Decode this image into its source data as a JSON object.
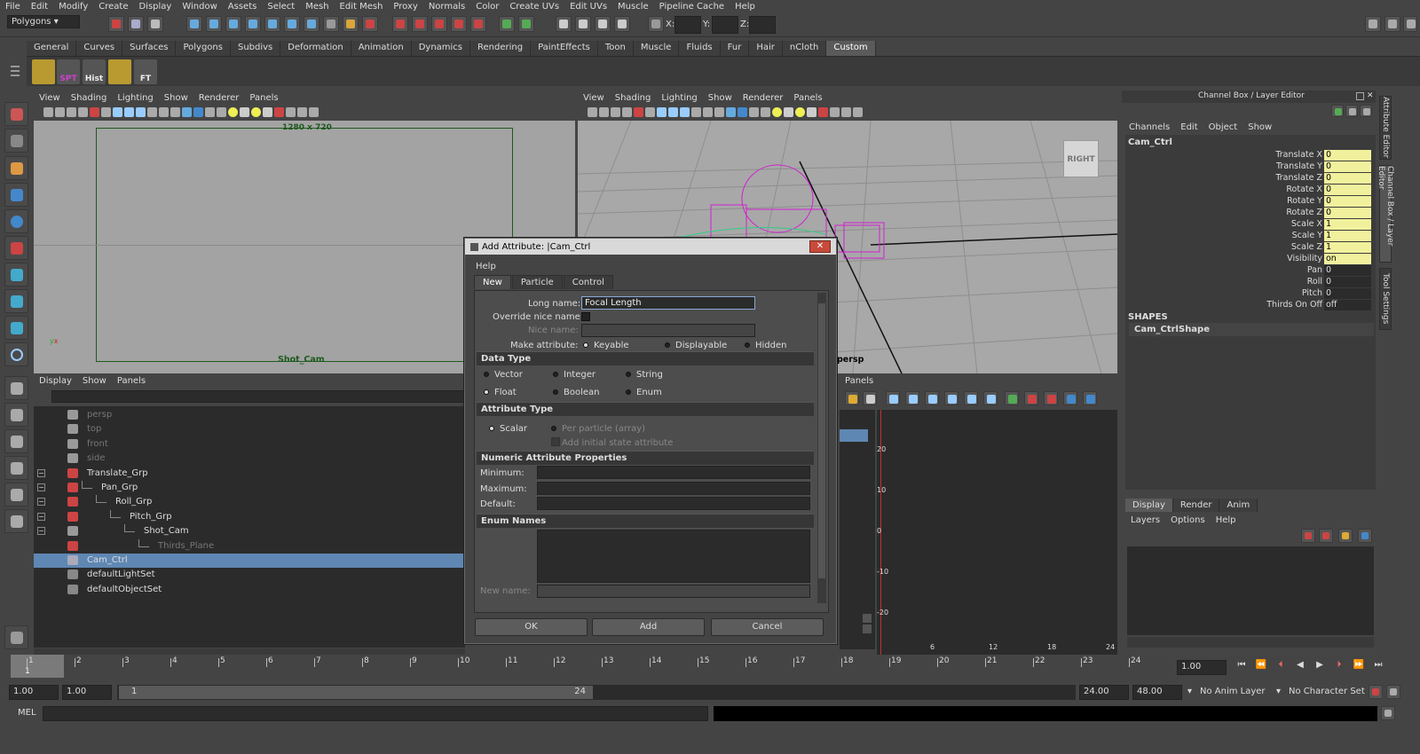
{
  "menubar": [
    "File",
    "Edit",
    "Modify",
    "Create",
    "Display",
    "Window",
    "Assets",
    "Select",
    "Mesh",
    "Edit Mesh",
    "Proxy",
    "Normals",
    "Color",
    "Create UVs",
    "Edit UVs",
    "Muscle",
    "Pipeline Cache",
    "Help"
  ],
  "status": {
    "menuset": "Polygons",
    "x_label": "X:",
    "y_label": "Y:",
    "z_label": "Z:"
  },
  "shelf": {
    "tabs": [
      "General",
      "Curves",
      "Surfaces",
      "Polygons",
      "Subdivs",
      "Deformation",
      "Animation",
      "Dynamics",
      "Rendering",
      "PaintEffects",
      "Toon",
      "Muscle",
      "Fluids",
      "Fur",
      "Hair",
      "nCloth",
      "Custom"
    ],
    "active": "Custom",
    "icons": [
      {
        "label": "",
        "color": "#c9a83a"
      },
      {
        "label": "SPT",
        "color": "#c03ac0"
      },
      {
        "label": "Hist",
        "color": "#dddddd"
      },
      {
        "label": "",
        "color": "#c9a83a"
      },
      {
        "label": "FT",
        "color": "#dddddd"
      }
    ]
  },
  "viewport_menu": [
    "View",
    "Shading",
    "Lighting",
    "Show",
    "Renderer",
    "Panels"
  ],
  "viewport1": {
    "resolution": "1280 x 720",
    "camera": "Shot_Cam"
  },
  "viewport2": {
    "camera": "persp",
    "viewcube": "RIGHT"
  },
  "outliner": {
    "menu": [
      "Display",
      "Show",
      "Panels"
    ],
    "items": [
      {
        "name": "persp",
        "level": 0,
        "dim": true
      },
      {
        "name": "top",
        "level": 0,
        "dim": true
      },
      {
        "name": "front",
        "level": 0,
        "dim": true
      },
      {
        "name": "side",
        "level": 0,
        "dim": true
      },
      {
        "name": "Translate_Grp",
        "level": 0,
        "dim": false
      },
      {
        "name": "Pan_Grp",
        "level": 1,
        "dim": false
      },
      {
        "name": "Roll_Grp",
        "level": 2,
        "dim": false
      },
      {
        "name": "Pitch_Grp",
        "level": 3,
        "dim": false
      },
      {
        "name": "Shot_Cam",
        "level": 4,
        "dim": false
      },
      {
        "name": "Thirds_Plane",
        "level": 5,
        "dim": true
      },
      {
        "name": "Cam_Ctrl",
        "level": 0,
        "dim": false,
        "selected": true
      },
      {
        "name": "defaultLightSet",
        "level": 0,
        "dim": false
      },
      {
        "name": "defaultObjectSet",
        "level": 0,
        "dim": false
      }
    ]
  },
  "graph": {
    "menu_partial": "Panels",
    "y_ticks": [
      "20",
      "10",
      "0",
      "-10",
      "-20"
    ],
    "x_ticks": [
      "6",
      "12",
      "18",
      "24"
    ]
  },
  "channelbox": {
    "title": "Channel Box / Layer Editor",
    "menu": [
      "Channels",
      "Edit",
      "Object",
      "Show"
    ],
    "object": "Cam_Ctrl",
    "attrs": [
      {
        "name": "Translate X",
        "value": "0",
        "keyed": true
      },
      {
        "name": "Translate Y",
        "value": "0",
        "keyed": true
      },
      {
        "name": "Translate Z",
        "value": "0",
        "keyed": true
      },
      {
        "name": "Rotate X",
        "value": "0",
        "keyed": true
      },
      {
        "name": "Rotate Y",
        "value": "0",
        "keyed": true
      },
      {
        "name": "Rotate Z",
        "value": "0",
        "keyed": true
      },
      {
        "name": "Scale X",
        "value": "1",
        "keyed": true
      },
      {
        "name": "Scale Y",
        "value": "1",
        "keyed": true
      },
      {
        "name": "Scale Z",
        "value": "1",
        "keyed": true
      },
      {
        "name": "Visibility",
        "value": "on",
        "keyed": true
      },
      {
        "name": "Pan",
        "value": "0",
        "keyed": false
      },
      {
        "name": "Roll",
        "value": "0",
        "keyed": false
      },
      {
        "name": "Pitch",
        "value": "0",
        "keyed": false
      },
      {
        "name": "Thirds On Off",
        "value": "off",
        "keyed": false
      }
    ],
    "shapes_label": "SHAPES",
    "shape": "Cam_CtrlShape"
  },
  "layer": {
    "tabs": [
      "Display",
      "Render",
      "Anim"
    ],
    "menu": [
      "Layers",
      "Options",
      "Help"
    ]
  },
  "sidetabs": [
    "Attribute Editor",
    "Channel Box / Layer Editor",
    "Tool Settings"
  ],
  "timeline": {
    "ticks": [
      "1",
      "2",
      "3",
      "4",
      "5",
      "6",
      "7",
      "8",
      "9",
      "10",
      "11",
      "12",
      "13",
      "14",
      "15",
      "16",
      "17",
      "18",
      "19",
      "20",
      "21",
      "22",
      "23",
      "24"
    ],
    "current": "1",
    "current_field": "1.00"
  },
  "range": {
    "start": "1.00",
    "start2": "1.00",
    "slider_start": "1",
    "slider_end": "24",
    "end": "24.00",
    "end2": "48.00",
    "anim_layer": "No Anim Layer",
    "char_set": "No Character Set"
  },
  "cmdline": {
    "label": "MEL"
  },
  "dialog": {
    "title": "Add Attribute: |Cam_Ctrl",
    "menu": "Help",
    "tabs": [
      "New",
      "Particle",
      "Control"
    ],
    "long_name_label": "Long name:",
    "long_name_value": "Focal Length",
    "override_label": "Override nice name:",
    "nice_name_label": "Nice name:",
    "make_attr_label": "Make attribute:",
    "make_options": [
      "Keyable",
      "Displayable",
      "Hidden"
    ],
    "data_type_header": "Data Type",
    "data_types": [
      "Vector",
      "Integer",
      "String",
      "Float",
      "Boolean",
      "Enum"
    ],
    "attr_type_header": "Attribute Type",
    "attr_types": [
      "Scalar",
      "Per particle (array)"
    ],
    "initial_state": "Add initial state attribute",
    "numeric_header": "Numeric Attribute Properties",
    "minimum": "Minimum:",
    "maximum": "Maximum:",
    "default": "Default:",
    "enum_header": "Enum Names",
    "new_name": "New name:",
    "ok": "OK",
    "add": "Add",
    "cancel": "Cancel",
    "close_glyph": "✕"
  }
}
